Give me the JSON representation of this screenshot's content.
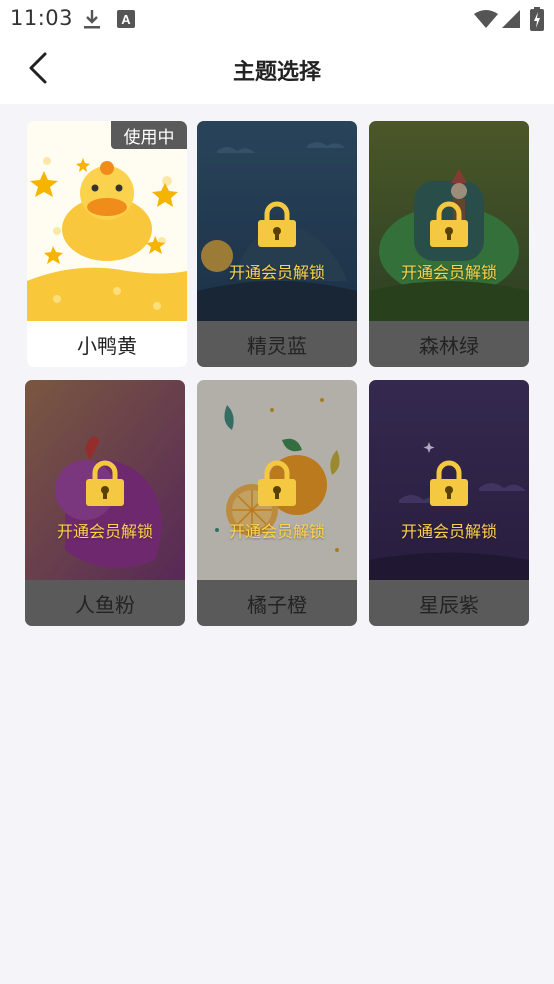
{
  "status_bar": {
    "time": "11:03"
  },
  "header": {
    "title": "主题选择"
  },
  "themes": [
    {
      "name": "小鸭黄",
      "badge": "使用中"
    },
    {
      "name": "精灵蓝",
      "unlock_text": "开通会员解锁"
    },
    {
      "name": "森林绿",
      "unlock_text": "开通会员解锁"
    },
    {
      "name": "人鱼粉",
      "unlock_text": "开通会员解锁"
    },
    {
      "name": "橘子橙",
      "unlock_text": "开通会员解锁"
    },
    {
      "name": "星辰紫",
      "unlock_text": "开通会员解锁"
    }
  ],
  "colors": {
    "lock": "#f5c842",
    "unlock_text": "#ffd24a",
    "page_bg": "#f4f4f9"
  }
}
